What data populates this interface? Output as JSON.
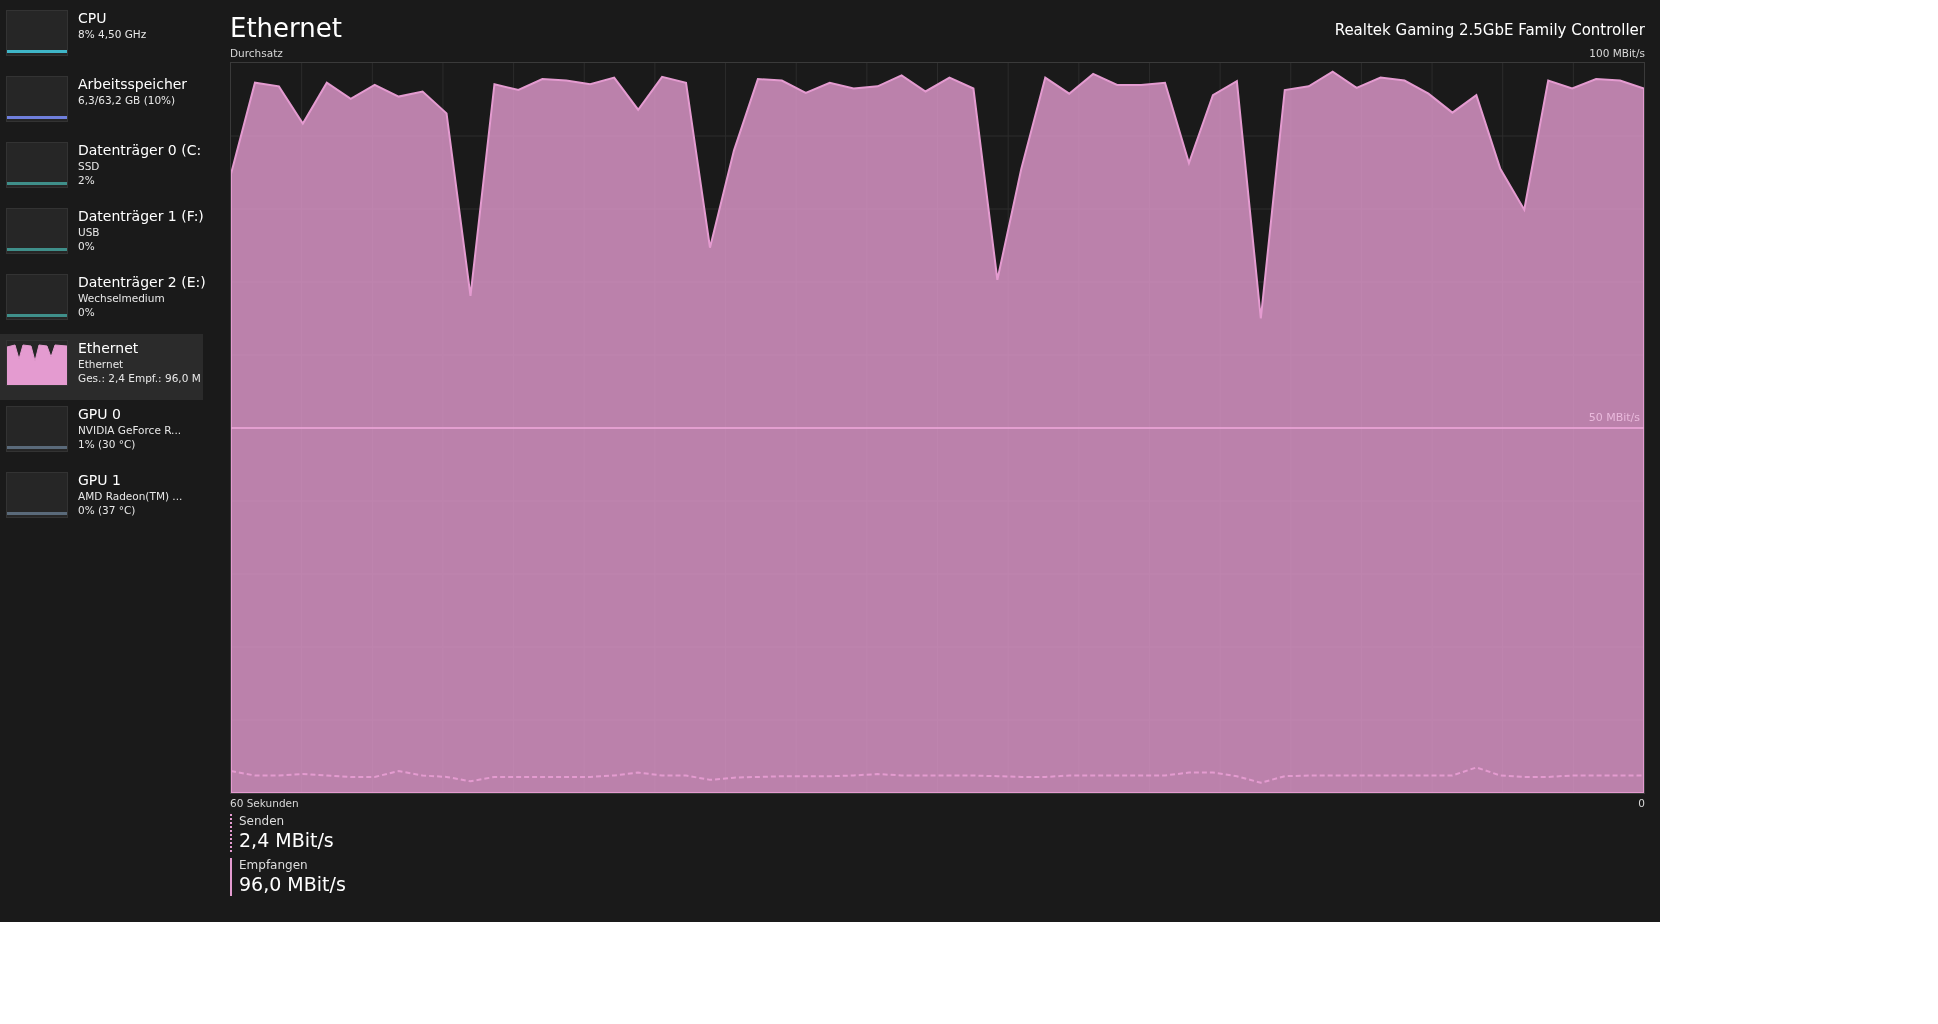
{
  "sidebar": {
    "items": [
      {
        "name": "CPU",
        "lines": [
          "8% 4,50 GHz"
        ],
        "selected": false,
        "color": "#3fb6c8",
        "kind": "line"
      },
      {
        "name": "Arbeitsspeicher",
        "lines": [
          "6,3/63,2 GB (10%)"
        ],
        "selected": false,
        "color": "#6f7fdc",
        "kind": "line"
      },
      {
        "name": "Datenträger 0 (C:",
        "lines": [
          "SSD",
          "2%"
        ],
        "selected": false,
        "color": "#3f8f8a",
        "kind": "line"
      },
      {
        "name": "Datenträger 1 (F:)",
        "lines": [
          "USB",
          "0%"
        ],
        "selected": false,
        "color": "#3f8f8a",
        "kind": "line"
      },
      {
        "name": "Datenträger 2 (E:)",
        "lines": [
          "Wechselmedium",
          "0%"
        ],
        "selected": false,
        "color": "#3f8f8a",
        "kind": "line"
      },
      {
        "name": "Ethernet",
        "lines": [
          "Ethernet",
          "Ges.: 2,4 Empf.: 96,0 M"
        ],
        "selected": true,
        "color": "#e49bd0",
        "kind": "area"
      },
      {
        "name": "GPU 0",
        "lines": [
          "NVIDIA GeForce R...",
          "1%  (30 °C)"
        ],
        "selected": false,
        "color": "#5a6a7a",
        "kind": "line"
      },
      {
        "name": "GPU 1",
        "lines": [
          "AMD Radeon(TM) ...",
          "0%  (37 °C)"
        ],
        "selected": false,
        "color": "#5a6a7a",
        "kind": "line"
      }
    ]
  },
  "header": {
    "title": "Ethernet",
    "device": "Realtek Gaming 2.5GbE Family Controller"
  },
  "graph": {
    "label": "Durchsatz",
    "max_label": "100 MBit/s",
    "mid_label": "50 MBit/s",
    "start_label": "60 Sekunden",
    "end_label": "0"
  },
  "legend": [
    {
      "label": "Senden",
      "value": "2,4 MBit/s",
      "kind": "dashed"
    },
    {
      "label": "Empfangen",
      "value": "96,0 MBit/s",
      "kind": "solid"
    }
  ]
}
